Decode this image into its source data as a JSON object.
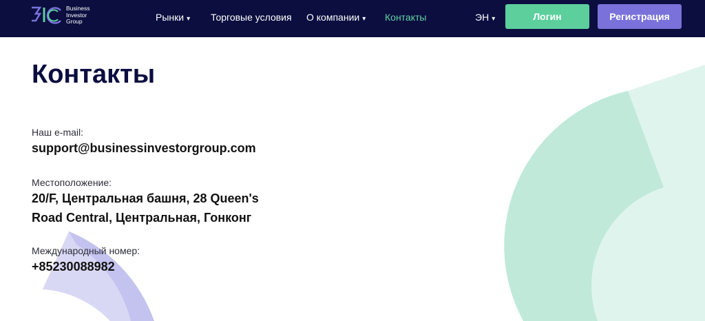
{
  "header": {
    "logo": {
      "line1": "Business",
      "line2": "Investor",
      "line3": "Group",
      "icon": "big-monogram-logo-icon"
    },
    "nav": [
      {
        "label": "Рынки",
        "has_dropdown": true
      },
      {
        "label": "Торговые условия",
        "has_dropdown": false
      },
      {
        "label": "О компании",
        "has_dropdown": true
      },
      {
        "label": "Контакты",
        "has_dropdown": false,
        "active": true
      }
    ],
    "dropdown_caret": "▾",
    "language": "ЭН",
    "login_label": "Логин",
    "register_label": "Регистрация"
  },
  "main": {
    "title": "Контакты",
    "email": {
      "label": "Наш e-mail:",
      "value": "support@businessinvestorgroup.com"
    },
    "location": {
      "label": "Местоположение:",
      "value_line1": "20/F, Центральная башня, 28 Queen's",
      "value_line2": "Road Central, Центральная, Гонконг"
    },
    "phone": {
      "label": "Международный номер:",
      "value": "+85230088982"
    }
  },
  "colors": {
    "header_bg": "#0b0e3f",
    "active_nav": "#62d3a4",
    "login_bg": "#5ccf9d",
    "register_bg": "#7a72da",
    "title": "#0b0e3f",
    "deco_green_dark": "#c0e9da",
    "deco_green_light": "#e0f4ee",
    "deco_purple_dark": "#c4c3ef",
    "deco_purple_light": "#d9d8f4"
  }
}
